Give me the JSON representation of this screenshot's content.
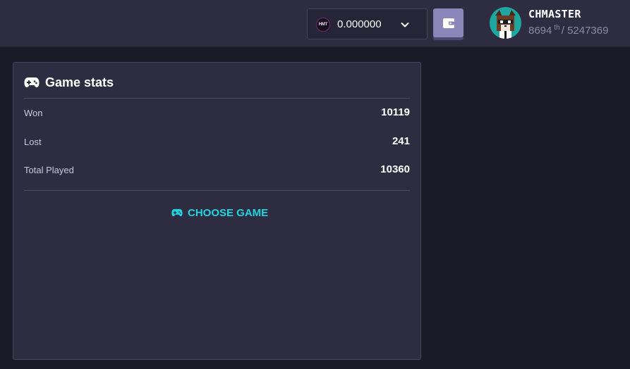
{
  "header": {
    "balance": {
      "coin_label": "HMT",
      "value": "0.000000"
    },
    "user": {
      "username": "CHMASTER",
      "rank": "8694",
      "rank_suffix": "th",
      "rank_separator": "/",
      "total_players": "5247369"
    }
  },
  "game_stats": {
    "title": "Game stats",
    "rows": [
      {
        "label": "Won",
        "value": "10119"
      },
      {
        "label": "Lost",
        "value": "241"
      },
      {
        "label": "Total Played",
        "value": "10360"
      }
    ],
    "choose_game_label": "CHOOSE GAME"
  },
  "colors": {
    "accent": "#22d3e0",
    "panel": "#2d2c40",
    "background": "#1b1b28",
    "wallet_button": "#8b85b9"
  },
  "icons": [
    "hmt-coin-icon",
    "chevron-down-icon",
    "wallet-icon",
    "gamepad-icon"
  ]
}
